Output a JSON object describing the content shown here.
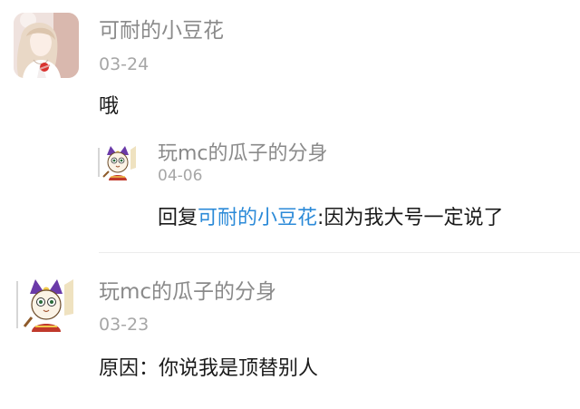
{
  "comments": [
    {
      "username": "可耐的小豆花",
      "date": "03-24",
      "text": "哦",
      "replies": [
        {
          "username": "玩mc的瓜子的分身",
          "date": "04-06",
          "reply_prefix": "回复",
          "mention": "可耐的小豆花",
          "separator": ":",
          "text": "因为我大号一定说了"
        }
      ]
    },
    {
      "username": "玩mc的瓜子的分身",
      "date": "03-23",
      "text": "原因：你说我是顶替别人"
    }
  ],
  "colors": {
    "username": "#8a8a8a",
    "date": "#a6a6a6",
    "text": "#1a1a1a",
    "mention": "#2b8ad8"
  },
  "icons": {
    "avatar_1": "anime-girl-avatar",
    "avatar_2": "cartoon-cat-avatar"
  }
}
